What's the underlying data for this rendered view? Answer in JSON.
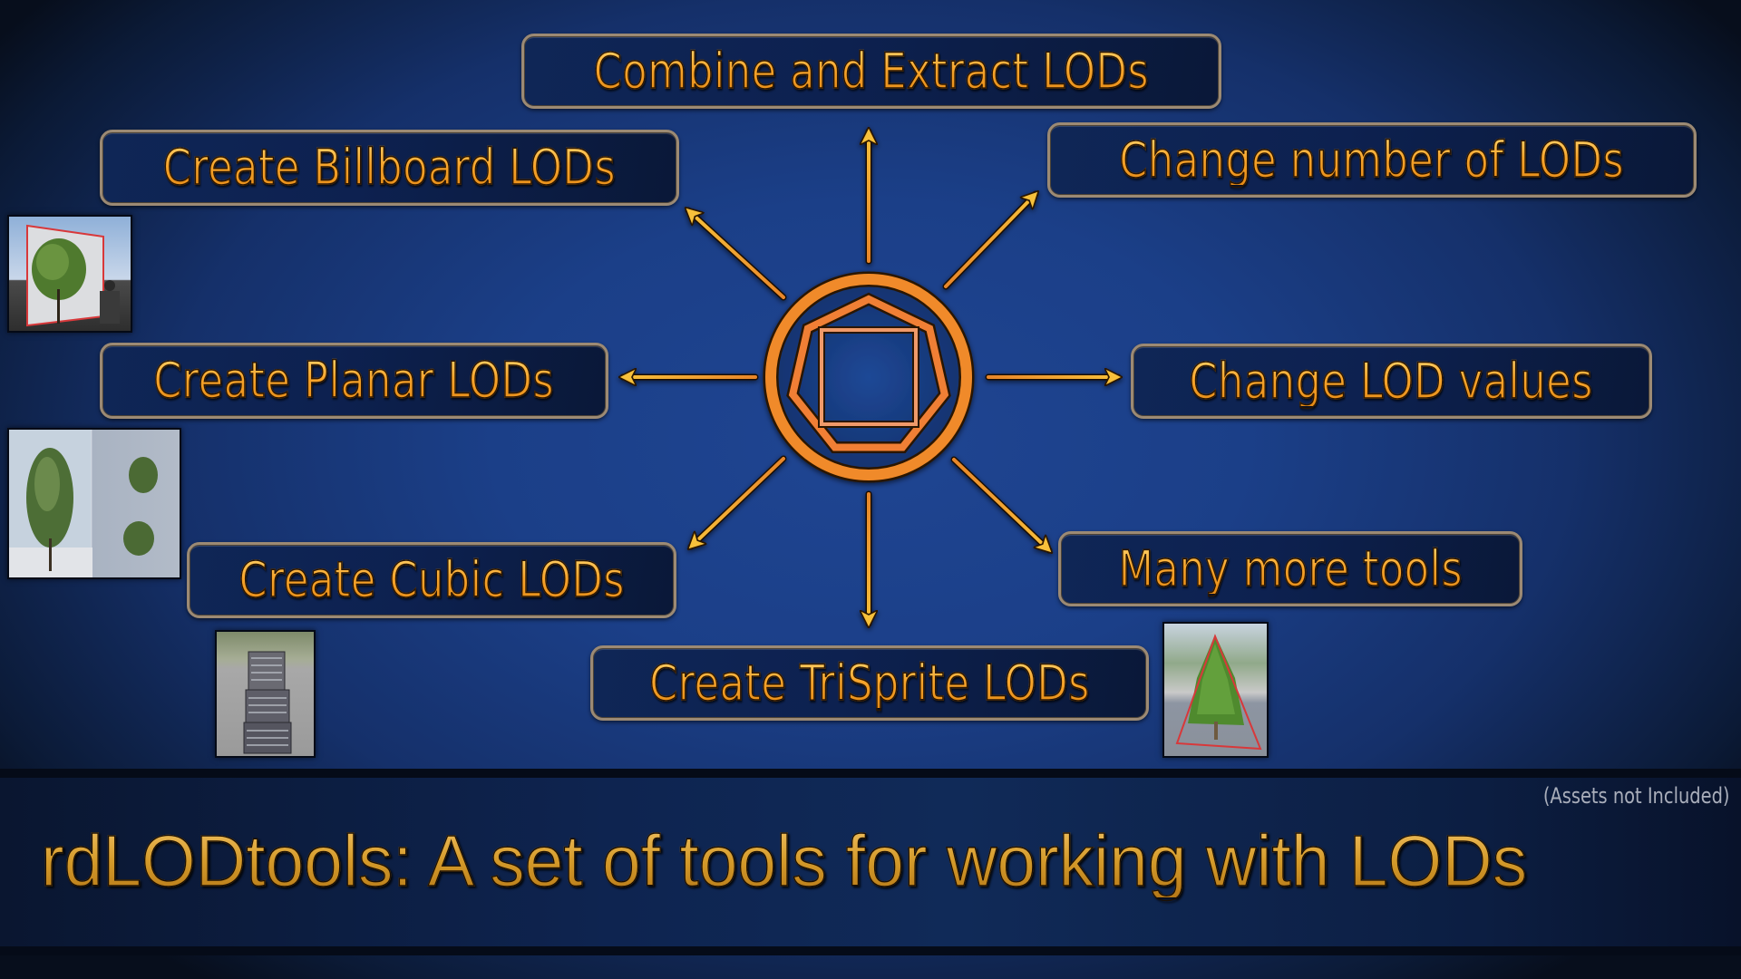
{
  "colors": {
    "background_center": "#1f4592",
    "background_edge": "#070e1c",
    "box_fill": "#0d2150",
    "box_border": "#9c8a74",
    "label_gold": "#f7a52c",
    "arrow_base": "#e8862a",
    "arrow_tip": "#f7c03a",
    "logo_orange": "#f08a2a",
    "thumb_outline_red": "#d8383a",
    "note_gray": "#a9aebb"
  },
  "features": {
    "combine": "Combine and Extract LODs",
    "billboard": "Create Billboard LODs",
    "number": "Change number of LODs",
    "planar": "Create Planar LODs",
    "values": "Change LOD values",
    "cubic": "Create Cubic LODs",
    "more": "Many more tools",
    "trisprite": "Create TriSprite LODs"
  },
  "center_logo": {
    "icon": "lod-logo-icon",
    "shapes": [
      "circle",
      "heptagon",
      "square"
    ]
  },
  "arrows": [
    "north",
    "north-east",
    "east",
    "south-east",
    "south",
    "south-west",
    "west",
    "north-west"
  ],
  "thumbnails": {
    "billboard": "tree billboard preview with character",
    "planar": "planar tree and bush preview",
    "cubic": "cubic building preview",
    "trisprite": "pine tree trisprite preview"
  },
  "banner": {
    "note": "(Assets not Included)",
    "title": "rdLODtools: A set of tools for working with LODs"
  }
}
